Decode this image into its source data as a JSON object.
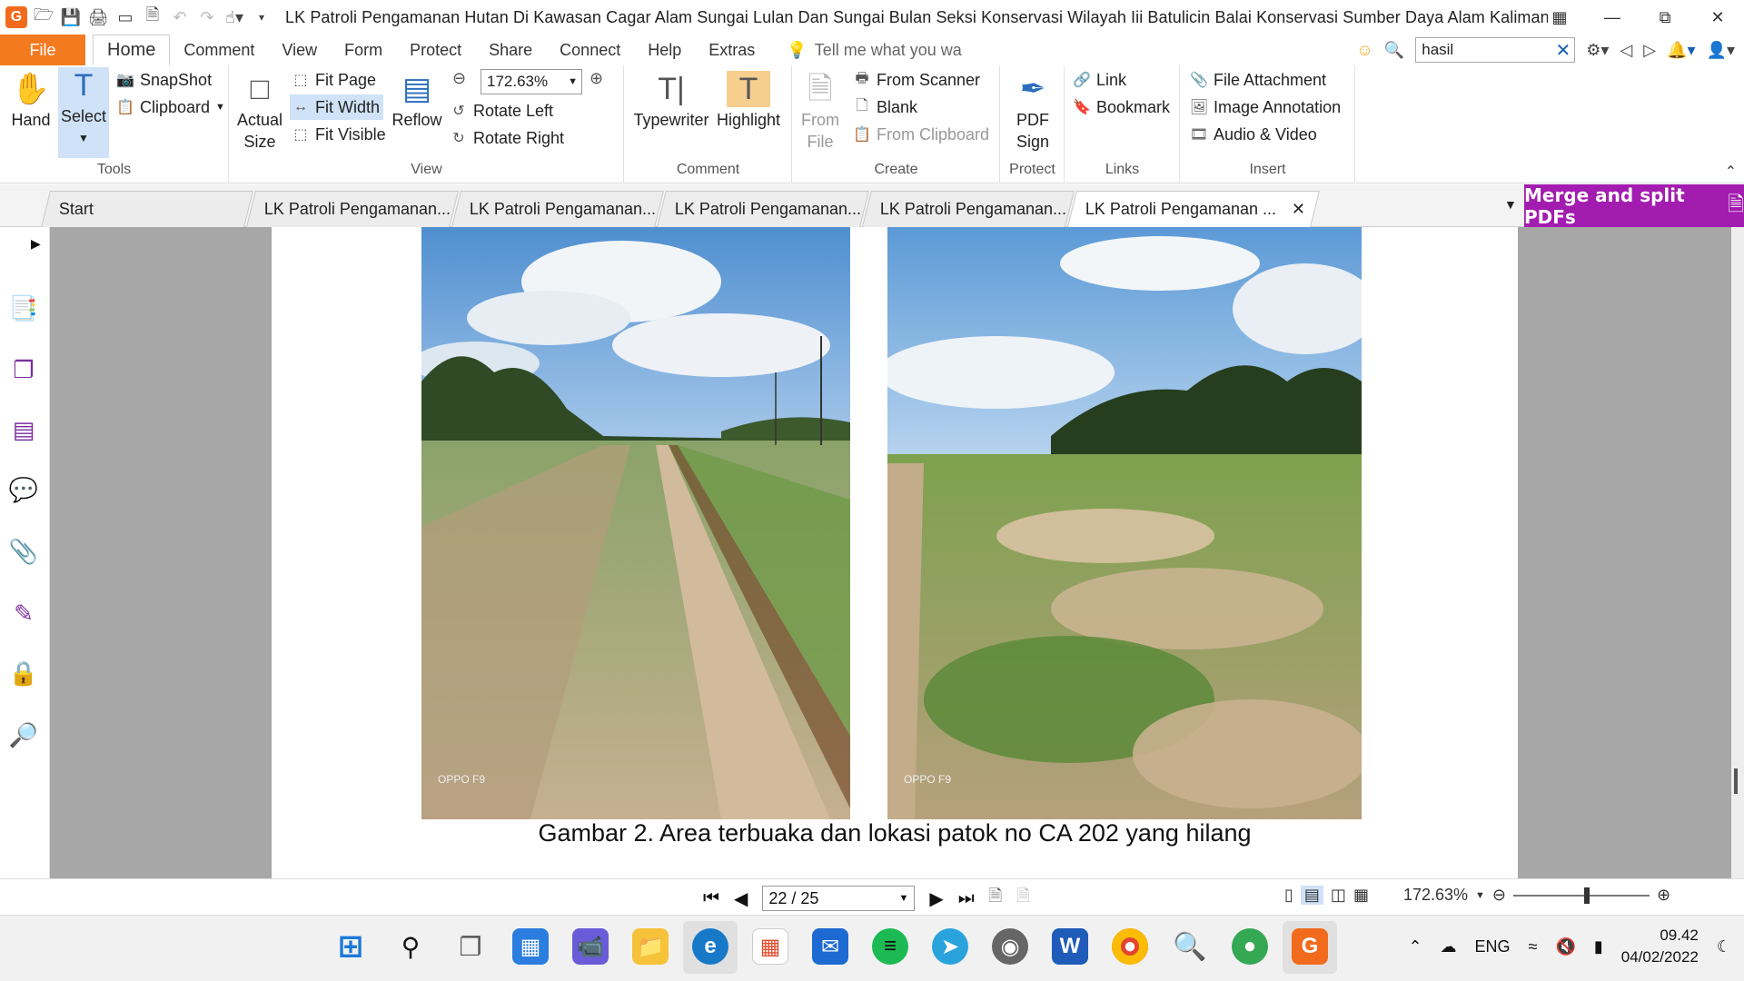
{
  "titlebar": {
    "title": "LK Patroli Pengamanan Hutan Di Kawasan Cagar Alam Sungai Lulan Dan Sungai Bulan Seksi Konservasi Wilayah Iii Batulicin Balai Konservasi Sumber Daya Alam Kalimantan..."
  },
  "menubar": {
    "file": "File",
    "tabs": [
      "Home",
      "Comment",
      "View",
      "Form",
      "Protect",
      "Share",
      "Connect",
      "Help",
      "Extras"
    ],
    "tell_me": "Tell me what you wa",
    "search_value": "hasil"
  },
  "ribbon": {
    "tools": {
      "label": "Tools",
      "hand": "Hand",
      "select": "Select",
      "snapshot": "SnapShot",
      "clipboard": "Clipboard"
    },
    "view": {
      "label": "View",
      "actual_size_1": "Actual",
      "actual_size_2": "Size",
      "fit_page": "Fit Page",
      "fit_width": "Fit Width",
      "fit_visible": "Fit Visible",
      "reflow": "Reflow",
      "zoom": "172.63%",
      "rotate_left": "Rotate Left",
      "rotate_right": "Rotate Right"
    },
    "comment": {
      "label": "Comment",
      "typewriter": "Typewriter",
      "highlight": "Highlight"
    },
    "create": {
      "label": "Create",
      "from_file_1": "From",
      "from_file_2": "File",
      "from_scanner": "From Scanner",
      "blank": "Blank",
      "from_clipboard": "From Clipboard"
    },
    "protect": {
      "label": "Protect",
      "pdf_sign_1": "PDF",
      "pdf_sign_2": "Sign"
    },
    "links": {
      "label": "Links",
      "link": "Link",
      "bookmark": "Bookmark"
    },
    "insert": {
      "label": "Insert",
      "file_attachment": "File Attachment",
      "image_annotation": "Image Annotation",
      "audio_video": "Audio & Video"
    }
  },
  "doctabs": {
    "tabs": [
      "Start",
      "LK Patroli Pengamanan...",
      "LK Patroli Pengamanan...",
      "LK Patroli Pengamanan...",
      "LK Patroli Pengamanan...",
      "LK Patroli Pengamanan ..."
    ],
    "merge_banner": "Merge and split PDFs"
  },
  "document": {
    "watermark_left": "OPPO F9",
    "watermark_right": "OPPO F9",
    "caption": "Gambar 2. Area terbuaka dan lokasi patok no CA 202 yang hilang"
  },
  "statusbar": {
    "page": "22 / 25",
    "zoom": "172.63%"
  },
  "taskbar": {
    "lang": "ENG",
    "time": "09.42",
    "date": "04/02/2022"
  }
}
